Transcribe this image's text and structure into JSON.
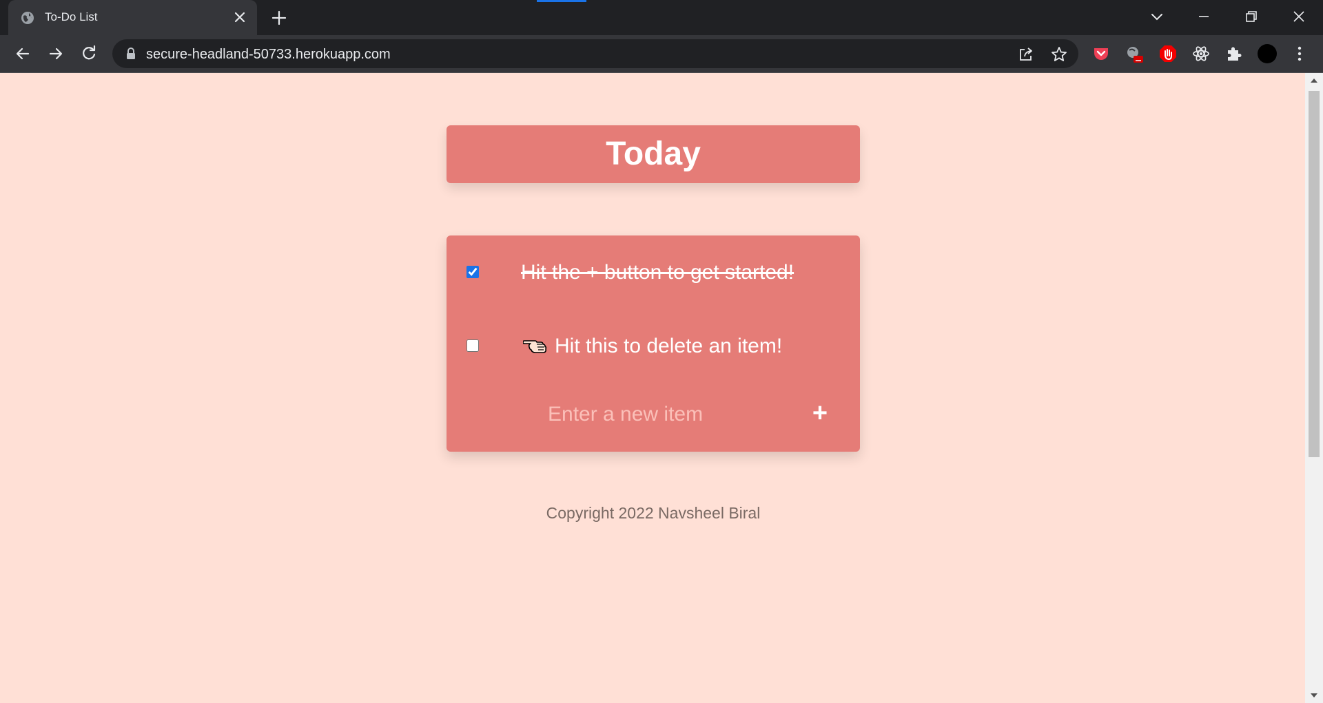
{
  "browser": {
    "tab": {
      "title": "To-Do List",
      "favicon": "globe-icon"
    },
    "url": "secure-headland-50733.herokuapp.com"
  },
  "page": {
    "heading": "Today",
    "items": [
      {
        "text": "Hit the + button to get started!",
        "checked": true
      },
      {
        "text": "Hit this to delete an item!",
        "checked": false
      }
    ],
    "new_item_placeholder": "Enter a new item",
    "add_label": "+",
    "footer": "Copyright 2022 Navsheel Biral"
  },
  "colors": {
    "page_background": "#ffe0d6",
    "card": "#e57c77",
    "browser_dark": "#202124",
    "browser_toolbar": "#35363a"
  }
}
